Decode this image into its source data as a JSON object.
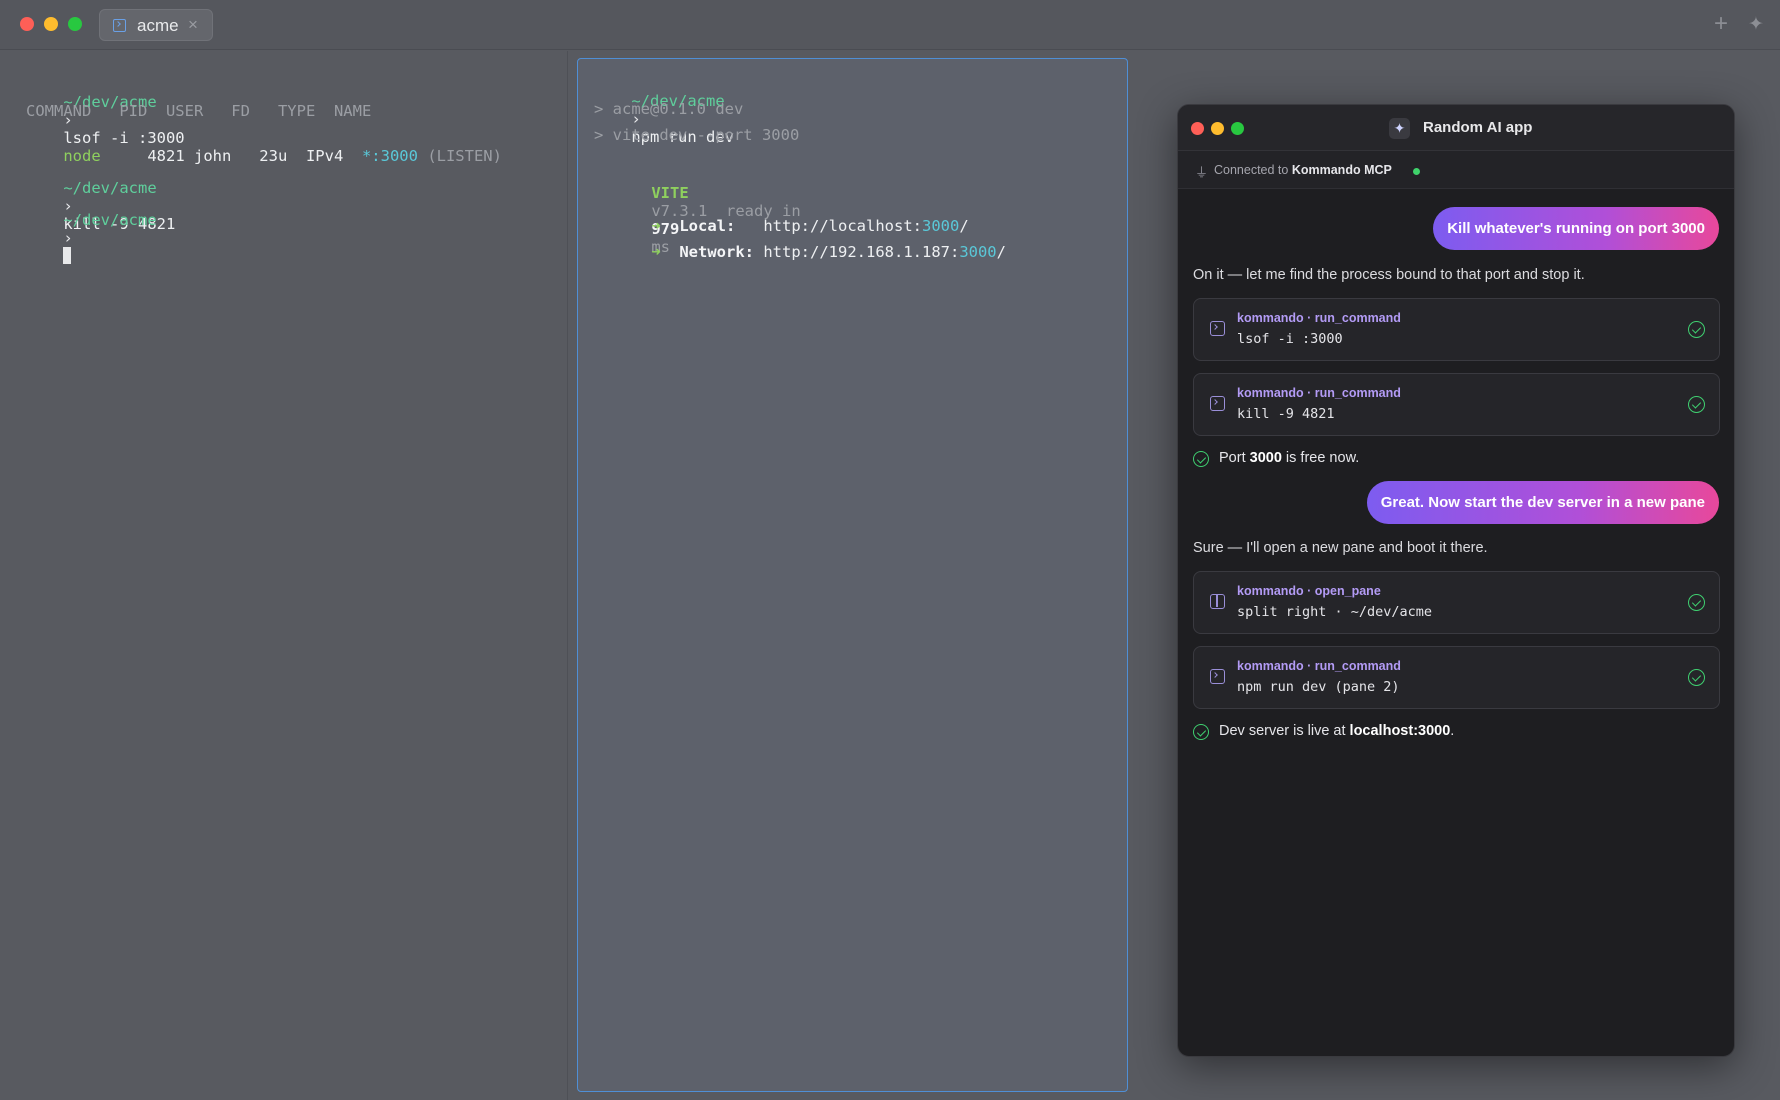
{
  "window": {
    "tab_label": "acme",
    "tab_close": "×",
    "new_tab": "+",
    "sparkle": "✦"
  },
  "pane1": {
    "l1_prompt": "~/dev/acme",
    "l1_chev": "›",
    "l1_cmd": "lsof -i :3000",
    "header": "COMMAND   PID  USER   FD   TYPE  NAME",
    "row_cmd": "node",
    "row_mid": "4821 john   23u  IPv4",
    "row_port": "*:3000",
    "row_state": "(LISTEN)",
    "l2_prompt": "~/dev/acme",
    "l2_chev": "›",
    "l2_cmd": "kill -9 4821",
    "l3_prompt": "~/dev/acme",
    "l3_chev": "›"
  },
  "pane2": {
    "prompt": "~/dev/acme",
    "chev": "›",
    "cmd": "npm run dev",
    "out1": "> acme@0.1.0 dev",
    "out2": "> vite dev --port 3000",
    "vite_label": "VITE",
    "vite_version": "v7.3.1",
    "ready_in": "ready in",
    "ready_ms": "979",
    "ms": "ms",
    "arrow": "➜",
    "local_label": "Local:",
    "local_url": "http://localhost:",
    "local_port": "3000",
    "slash": "/",
    "network_label": "Network:",
    "network_url": "http://192.168.1.187:",
    "network_port": "3000"
  },
  "ai_app": {
    "title": "Random AI app",
    "logo": "✦",
    "connected_prefix": "Connected to",
    "connected_name": "Kommando MCP",
    "plug": "⏚",
    "user_msg_1": "Kill whatever's running on port 3000",
    "assistant_1": "On it — let me find the process bound to that port and stop it.",
    "tool_1_name": "kommando · run_command",
    "tool_1_cmd": "lsof -i :3000",
    "tool_2_name": "kommando · run_command",
    "tool_2_cmd": "kill -9 4821",
    "status_1_a": "Port",
    "status_1_b": "3000",
    "status_1_c": "is free now.",
    "user_msg_2": "Great. Now start the dev server in a new pane",
    "assistant_2": "Sure — I'll open a new pane and boot it there.",
    "tool_3_name": "kommando · open_pane",
    "tool_3_cmd": "split right · ~/dev/acme",
    "tool_4_name": "kommando · run_command",
    "tool_4_cmd": "npm run dev (pane 2)",
    "status_2_a": "Dev server is live at",
    "status_2_b": "localhost:3000",
    "status_2_c": "."
  },
  "colors": {
    "prompt": "#5fcf9c",
    "accent_port": "#5ac8d8",
    "pane_focus_border": "#4f8fd6",
    "success": "#3fcf70",
    "bubble_start": "#7d5cf0",
    "bubble_end": "#e8489b"
  }
}
